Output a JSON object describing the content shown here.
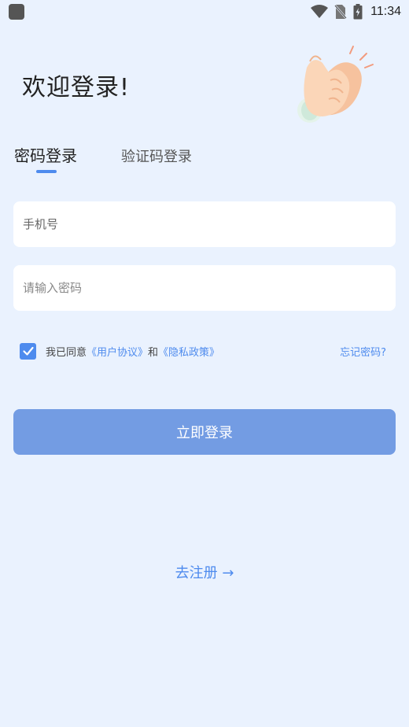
{
  "status_bar": {
    "time": "11:34"
  },
  "header": {
    "title": "欢迎登录!"
  },
  "tabs": {
    "password_login": "密码登录",
    "sms_login": "验证码登录"
  },
  "form": {
    "phone_placeholder": "手机号",
    "password_placeholder": "请输入密码"
  },
  "agreement": {
    "prefix": "我已同意",
    "user_agreement": "《用户协议》",
    "conjunction": "和",
    "privacy_policy": "《隐私政策》",
    "checked": true,
    "forgot_password": "忘记密码?"
  },
  "actions": {
    "login_label": "立即登录",
    "register_label": "去注册 →"
  },
  "colors": {
    "accent": "#4E8BEE",
    "button": "#739CE3",
    "background": "#EAF2FE"
  }
}
